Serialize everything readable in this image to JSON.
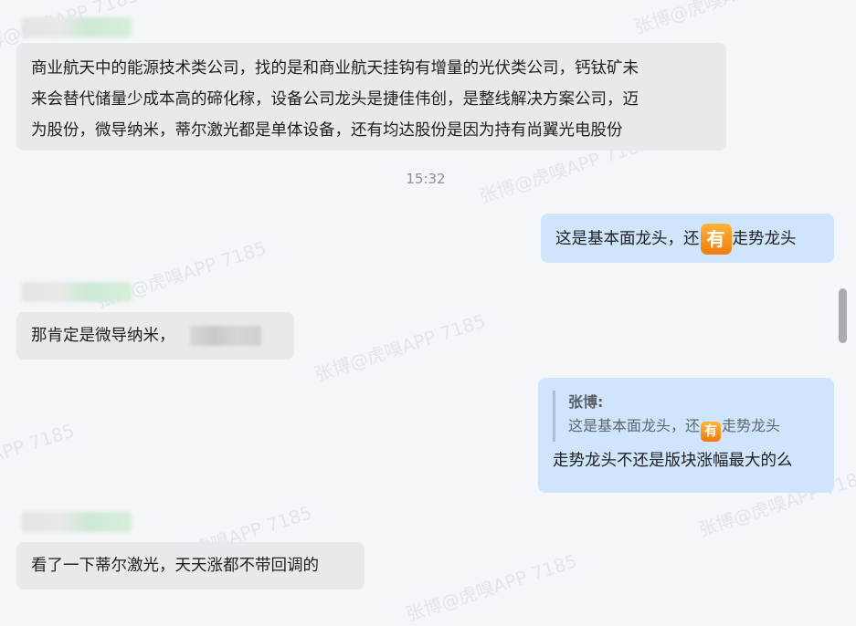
{
  "watermark_text": "张博@虎嗅APP 7185",
  "messages": {
    "m1": {
      "line1": "商业航天中的能源技术类公司，找的是和商业航天挂钩有增量的光伏类公司，钙钛矿未",
      "line2": "来会替代储量少成本高的碲化稼，设备公司龙头是捷佳伟创，是整线解决方案公司，迈",
      "line3": "为股份，微导纳米，蒂尔激光都是单体设备，还有均达股份是因为持有尚翼光电股份"
    },
    "timestamp": "15:32",
    "m2": {
      "before": "这是基本面龙头，还",
      "emoji": "有",
      "after": "走势龙头"
    },
    "m3": {
      "text": "那肯定是微导纳米，"
    },
    "m4": {
      "quote_author": "张博:",
      "quote_before": "这是基本面龙头，还",
      "quote_emoji": "有",
      "quote_after": "走势龙头",
      "text": "走势龙头不还是版块涨幅最大的么"
    },
    "m5": {
      "text": "看了一下蒂尔激光，天天涨都不带回调的"
    }
  },
  "colors": {
    "background": "#f5f6fa",
    "incoming_bubble": "#e8e9ec",
    "outgoing_bubble": "#cfe5fd",
    "emoji_orange": "#f17b0c"
  }
}
